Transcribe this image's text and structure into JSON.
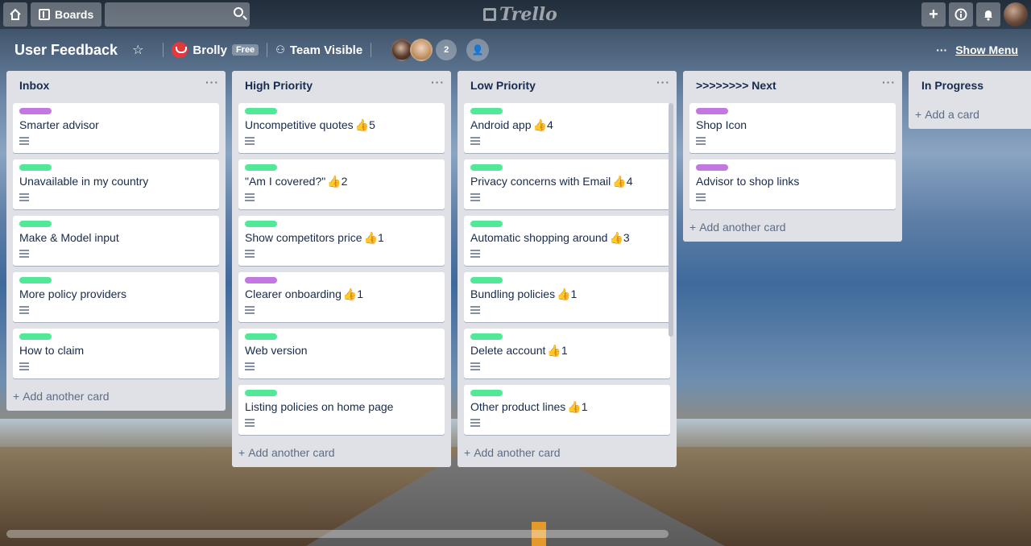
{
  "topbar": {
    "boards_label": "Boards",
    "search_placeholder": "",
    "logo_text": "Trello"
  },
  "board": {
    "title": "User Feedback",
    "team_name": "Brolly",
    "team_badge": "Free",
    "visibility": "Team Visible",
    "member_count": "2",
    "show_menu": "Show Menu"
  },
  "lists": [
    {
      "title": "Inbox",
      "cards": [
        {
          "label": "purple",
          "title": "Smarter advisor",
          "thumbs": ""
        },
        {
          "label": "green",
          "title": "Unavailable in my country",
          "thumbs": ""
        },
        {
          "label": "green",
          "title": "Make & Model input",
          "thumbs": ""
        },
        {
          "label": "green",
          "title": "More policy providers",
          "thumbs": ""
        },
        {
          "label": "green",
          "title": "How to claim",
          "thumbs": ""
        }
      ],
      "add_label": "Add another card"
    },
    {
      "title": "High Priority",
      "cards": [
        {
          "label": "green",
          "title": "Uncompetitive quotes",
          "thumbs": "👍5"
        },
        {
          "label": "green",
          "title": "\"Am I covered?\"",
          "thumbs": "👍2"
        },
        {
          "label": "green",
          "title": "Show competitors price",
          "thumbs": "👍1"
        },
        {
          "label": "purple",
          "title": "Clearer onboarding",
          "thumbs": "👍1"
        },
        {
          "label": "green",
          "title": "Web version",
          "thumbs": ""
        },
        {
          "label": "green",
          "title": "Listing policies on home page",
          "thumbs": ""
        }
      ],
      "add_label": "Add another card"
    },
    {
      "title": "Low Priority",
      "cards": [
        {
          "label": "green",
          "title": "Android app",
          "thumbs": "👍4"
        },
        {
          "label": "green",
          "title": "Privacy concerns with Email",
          "thumbs": "👍4"
        },
        {
          "label": "green",
          "title": "Automatic shopping around",
          "thumbs": "👍3"
        },
        {
          "label": "green",
          "title": "Bundling policies",
          "thumbs": "👍1"
        },
        {
          "label": "green",
          "title": "Delete account",
          "thumbs": "👍1"
        },
        {
          "label": "green",
          "title": "Other product lines",
          "thumbs": "👍1"
        }
      ],
      "add_label": "Add another card"
    },
    {
      "title": ">>>>>>>> Next",
      "cards": [
        {
          "label": "purple",
          "title": "Shop Icon",
          "thumbs": ""
        },
        {
          "label": "purple",
          "title": "Advisor to shop links",
          "thumbs": ""
        }
      ],
      "add_label": "Add another card"
    },
    {
      "title": "In Progress",
      "cards": [],
      "add_label": "Add a card"
    }
  ],
  "colors": {
    "label_green": "#51e898",
    "label_purple": "#c377e0",
    "list_bg": "#dfe1e6"
  }
}
